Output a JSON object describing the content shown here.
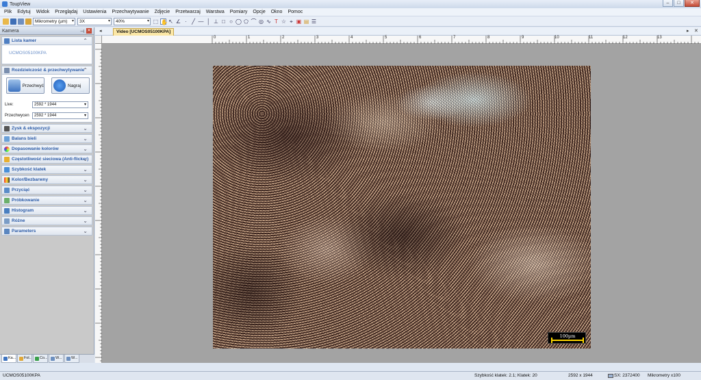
{
  "window": {
    "title": "ToupView",
    "minimize": "–",
    "maximize": "□",
    "close": "✕"
  },
  "menu": [
    "Plik",
    "Edytuj",
    "Widok",
    "Przeglądaj",
    "Ustawienia",
    "Przechwytywanie",
    "Zdjęcie",
    "Przetwarzaj",
    "Warstwa",
    "Pomiary",
    "Opcje",
    "Okno",
    "Pomoc"
  ],
  "toolbar": {
    "unit_value": "Mikrometry (µm)",
    "objective_value": "3X",
    "zoom_value": "40%"
  },
  "left_panel": {
    "title": "Kamera",
    "camera_list": {
      "title": "Lista kamer",
      "camera_name": "UCMOS05100KPA"
    },
    "capture": {
      "title": "Rozdzielczość & przechwytywanie",
      "capture_button": "Przechwyć",
      "record_button": "Nagraj",
      "live_label": "Live:",
      "live_value": "2592 * 1944",
      "snap_label": "Przechwycen",
      "snap_value": "2592 * 1944"
    },
    "sections": [
      "Zysk & ekspozycji",
      "Balans bieli",
      "Dopasowanie kolorów",
      "Częstotliwość sieciowa (Anti-flicker)",
      "Szybkość klatek",
      "Kolor/Bezbarwny",
      "Przyciąć",
      "Próbkowanie",
      "Histogram",
      "Różne",
      "Parameters"
    ],
    "tabs": [
      "Ka...",
      "Fol...",
      "Co...",
      "W...",
      "W..."
    ]
  },
  "document": {
    "tab_label": "Video [UCMOS05100KPA]",
    "ruler_ticks": [
      "0",
      "1",
      "2",
      "3",
      "4",
      "5",
      "6",
      "7",
      "8",
      "9",
      "10",
      "11",
      "12",
      "13"
    ],
    "scale_bar": "100µm"
  },
  "status": {
    "camera": "UCMOS05100KPA",
    "fps": "Szybkość klatek: 2.1; Klatek: 20",
    "resolution": "2592 x 1944",
    "position": "SX: 2372400",
    "unit": "Mikrometry x100"
  }
}
